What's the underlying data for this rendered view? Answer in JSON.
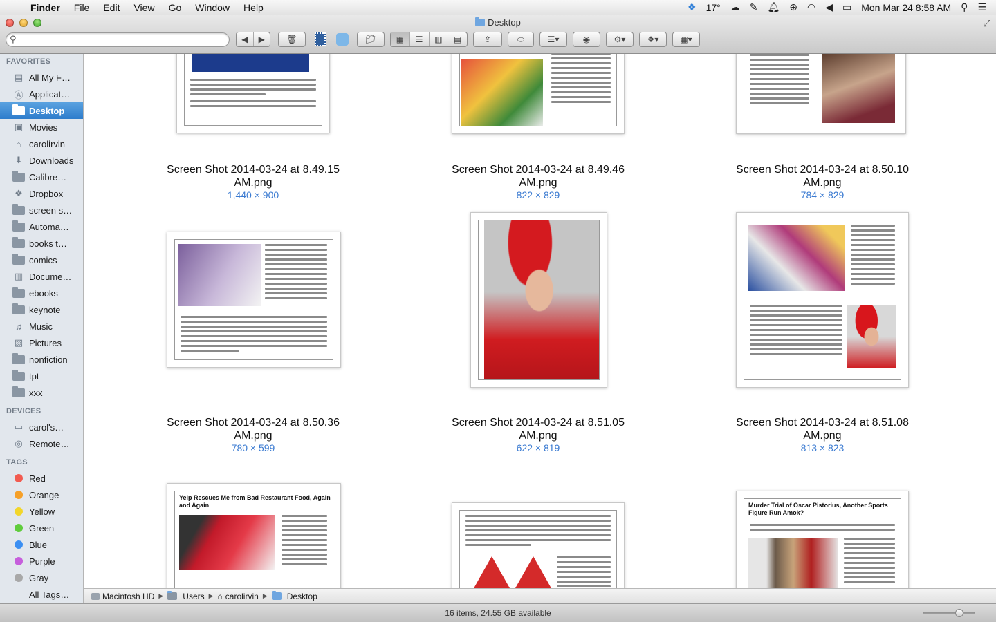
{
  "menubar": {
    "app": "Finder",
    "items": [
      "File",
      "Edit",
      "View",
      "Go",
      "Window",
      "Help"
    ],
    "temperature": "17°",
    "datetime": "Mon Mar 24  8:58 AM"
  },
  "window": {
    "title": "Desktop",
    "search_placeholder": ""
  },
  "sidebar": {
    "favorites_header": "FAVORITES",
    "favorites": [
      {
        "label": "All My F…",
        "icon": "all-files-icon"
      },
      {
        "label": "Applicat…",
        "icon": "applications-icon"
      },
      {
        "label": "Desktop",
        "icon": "folder-icon",
        "selected": true
      },
      {
        "label": "Movies",
        "icon": "movies-icon"
      },
      {
        "label": "carolirvin",
        "icon": "home-icon"
      },
      {
        "label": "Downloads",
        "icon": "downloads-icon"
      },
      {
        "label": "Calibre…",
        "icon": "folder-icon"
      },
      {
        "label": "Dropbox",
        "icon": "dropbox-icon"
      },
      {
        "label": "screen s…",
        "icon": "folder-icon"
      },
      {
        "label": "Automa…",
        "icon": "folder-icon"
      },
      {
        "label": "books t…",
        "icon": "folder-icon"
      },
      {
        "label": "comics",
        "icon": "folder-icon"
      },
      {
        "label": "Docume…",
        "icon": "documents-icon"
      },
      {
        "label": "ebooks",
        "icon": "folder-icon"
      },
      {
        "label": "keynote",
        "icon": "folder-icon"
      },
      {
        "label": "Music",
        "icon": "music-icon"
      },
      {
        "label": "Pictures",
        "icon": "pictures-icon"
      },
      {
        "label": "nonfiction",
        "icon": "folder-icon"
      },
      {
        "label": "tpt",
        "icon": "folder-icon"
      },
      {
        "label": "xxx",
        "icon": "folder-icon"
      }
    ],
    "devices_header": "DEVICES",
    "devices": [
      {
        "label": "carol's…",
        "icon": "laptop-icon"
      },
      {
        "label": "Remote…",
        "icon": "disc-icon"
      }
    ],
    "tags_header": "TAGS",
    "tags": [
      {
        "label": "Red",
        "color": "#f25b50"
      },
      {
        "label": "Orange",
        "color": "#f6a028"
      },
      {
        "label": "Yellow",
        "color": "#f2d62a"
      },
      {
        "label": "Green",
        "color": "#5fcc3c"
      },
      {
        "label": "Blue",
        "color": "#3b8ff2"
      },
      {
        "label": "Purple",
        "color": "#c65edc"
      },
      {
        "label": "Gray",
        "color": "#a8a8a8"
      },
      {
        "label": "All Tags…",
        "color": "none"
      }
    ]
  },
  "files": [
    {
      "name1": "Screen Shot 2014-03-24 at 8.49.15",
      "name2": "AM.png",
      "size": "1,440 × 900"
    },
    {
      "name1": "Screen Shot 2014-03-24 at 8.49.46",
      "name2": "AM.png",
      "size": "822 × 829"
    },
    {
      "name1": "Screen Shot 2014-03-24 at 8.50.10",
      "name2": "AM.png",
      "size": "784 × 829"
    },
    {
      "name1": "Screen Shot 2014-03-24 at 8.50.36",
      "name2": "AM.png",
      "size": "780 × 599"
    },
    {
      "name1": "Screen Shot 2014-03-24 at 8.51.05",
      "name2": "AM.png",
      "size": "622 × 819"
    },
    {
      "name1": "Screen Shot 2014-03-24 at 8.51.08",
      "name2": "AM.png",
      "size": "813 × 823"
    }
  ],
  "thumb_text": {
    "t7_title": "Yelp Rescues Me from Bad Restaurant Food, Again and Again",
    "t9_title": "Murder Trial of Oscar Pistorius, Another Sports Figure Run Amok?"
  },
  "pathbar": [
    "Macintosh HD",
    "Users",
    "carolirvin",
    "Desktop"
  ],
  "status": "16 items, 24.55 GB available",
  "zoom_fraction": 0.7
}
